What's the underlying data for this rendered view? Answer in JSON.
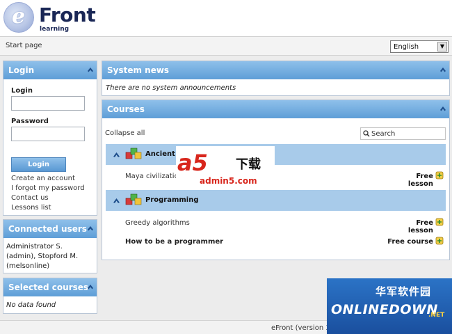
{
  "header": {
    "logo_e": "e",
    "logo_front": "Front",
    "logo_learning": "learning"
  },
  "topbar": {
    "start_page": "Start page",
    "language": "English"
  },
  "login": {
    "title": "Login",
    "login_label": "Login",
    "password_label": "Password",
    "button": "Login",
    "links": [
      "Create an account",
      "I forgot my password",
      "Contact us",
      "Lessons list"
    ]
  },
  "connected_users": {
    "title": "Connected users",
    "lines": [
      "Administrator S.",
      "(admin), Stopford M.",
      "(melsonline)"
    ]
  },
  "selected_courses": {
    "title": "Selected courses",
    "empty": "No data found"
  },
  "system_news": {
    "title": "System news",
    "empty": "There are no system announcements"
  },
  "courses": {
    "title": "Courses",
    "collapse_all": "Collapse all",
    "search_placeholder": "Search",
    "categories": [
      {
        "name": "Ancient C",
        "lessons": [
          {
            "name": "Maya civilization",
            "status": "Free lesson"
          }
        ]
      },
      {
        "name": "Programming",
        "lessons": [
          {
            "name": "Greedy algorithms",
            "status": "Free lesson"
          },
          {
            "name": "How to be a programmer",
            "status": "Free course"
          }
        ]
      }
    ]
  },
  "footer": {
    "text": "eFront (version 3."
  },
  "watermarks": {
    "a5_main": "a5",
    "a5_cn": "下载",
    "a5_url": "admin5.com",
    "onl_cn": "华军软件园",
    "onl_main": "ONLINEDOWN",
    "onl_net": ".NET"
  },
  "colors": {
    "panel_head": "#5e9ed7",
    "category_bar": "#a8cbea",
    "accent_red": "#d8261c"
  }
}
